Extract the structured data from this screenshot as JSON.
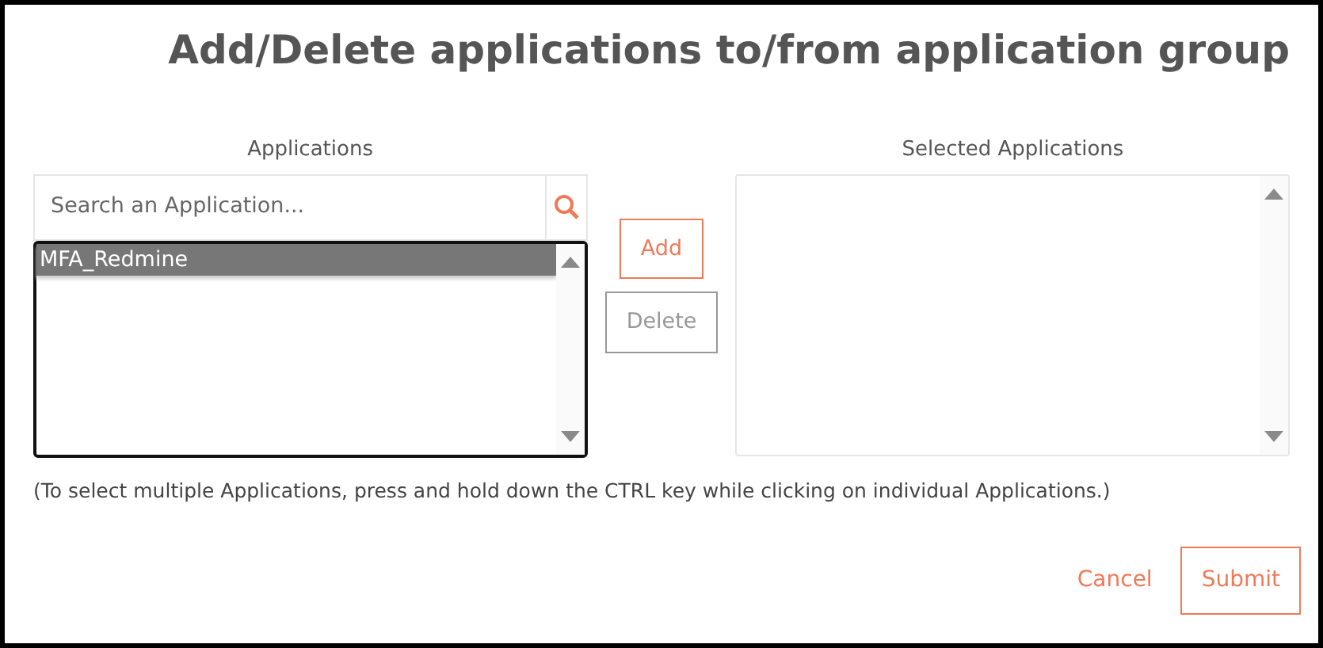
{
  "title": "Add/Delete applications to/from application group",
  "available": {
    "label": "Applications",
    "search": {
      "placeholder": "Search an Application..."
    },
    "items": [
      {
        "label": "MFA_Redmine",
        "selected": true
      }
    ]
  },
  "actions": [
    {
      "label": "Add",
      "disabled": false
    },
    {
      "label": "Delete",
      "disabled": true
    }
  ],
  "selected_list": {
    "label": "Selected Applications"
  },
  "hint": "(To select multiple Applications, press and hold down the CTRL key while clicking on individual Applications.)",
  "footer": {
    "cancel": "Cancel",
    "submit": "Submit"
  }
}
